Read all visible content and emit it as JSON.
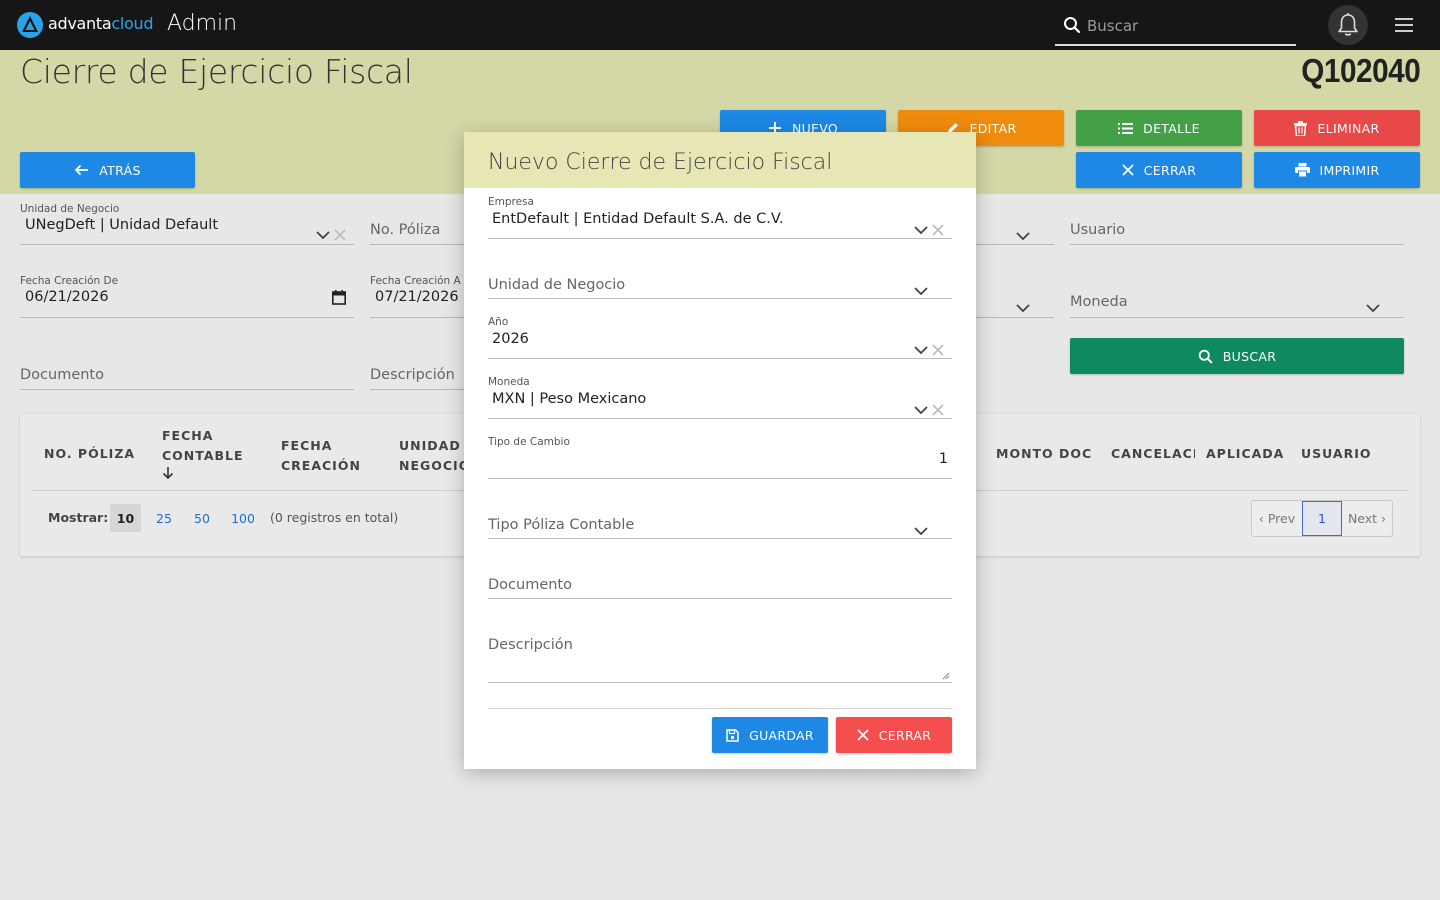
{
  "topbar": {
    "brand_a": "advanta",
    "brand_b": "cloud",
    "section": "Admin",
    "search_placeholder": "Buscar"
  },
  "header": {
    "title": "Cierre de Ejercicio Fiscal",
    "code": "Q102040"
  },
  "actions": {
    "nuevo": "NUEVO",
    "editar": "EDITAR",
    "detalle": "DETALLE",
    "eliminar": "ELIMINAR",
    "atras": "ATRÁS",
    "cerrar": "CERRAR",
    "imprimir": "IMPRIMIR",
    "buscar": "BUSCAR"
  },
  "filters": {
    "unidad_label": "Unidad de Negocio",
    "unidad_value": "UNegDeft | Unidad Default",
    "poliza_placeholder": "No. Póliza",
    "usuario_placeholder": "Usuario",
    "fecha_de_label": "Fecha Creación De",
    "fecha_de_value": "06/21/2026",
    "fecha_a_label": "Fecha Creación A",
    "fecha_a_value": "07/21/2026",
    "moneda_placeholder": "Moneda",
    "documento_placeholder": "Documento",
    "descripcion_placeholder": "Descripción"
  },
  "table": {
    "columns": {
      "poliza": "NO. PÓLIZA",
      "fecha_contable_1": "FECHA",
      "fecha_contable_2": "CONTABLE",
      "fecha_creacion_1": "FECHA",
      "fecha_creacion_2": "CREACIÓN",
      "unidad_1": "UNIDAD",
      "unidad_2": "NEGOCIO",
      "monto": "MONTO DOC",
      "cancelacion": "CANCELACIÓ",
      "aplicada": "APLICADA",
      "usuario": "USUARIO"
    },
    "mostrar": "Mostrar:",
    "page_sizes": [
      "10",
      "25",
      "50",
      "100"
    ],
    "total": "(0 registros en total)",
    "prev": "‹ Prev",
    "current_page": "1",
    "next": "Next ›"
  },
  "modal": {
    "title": "Nuevo Cierre de Ejercicio Fiscal",
    "empresa_label": "Empresa",
    "empresa_value": "EntDefault | Entidad Default S.A. de C.V.",
    "unidad_placeholder": "Unidad de Negocio",
    "anio_label": "Año",
    "anio_value": "2026",
    "moneda_label": "Moneda",
    "moneda_value": "MXN | Peso Mexicano",
    "tipo_cambio_label": "Tipo de Cambio",
    "tipo_cambio_value": "1",
    "tipo_poliza_placeholder": "Tipo Póliza Contable",
    "documento_placeholder": "Documento",
    "descripcion_placeholder": "Descripción",
    "guardar": "GUARDAR",
    "cerrar": "CERRAR"
  },
  "colors": {
    "topbar": "#161616",
    "header_band": "#d4d8a6",
    "blue": "#1e88e5",
    "orange": "#ef8c0e",
    "green": "#43a047",
    "red": "#e94848",
    "dark_green": "#0f8a5f",
    "brand_accent": "#29a3e6"
  }
}
